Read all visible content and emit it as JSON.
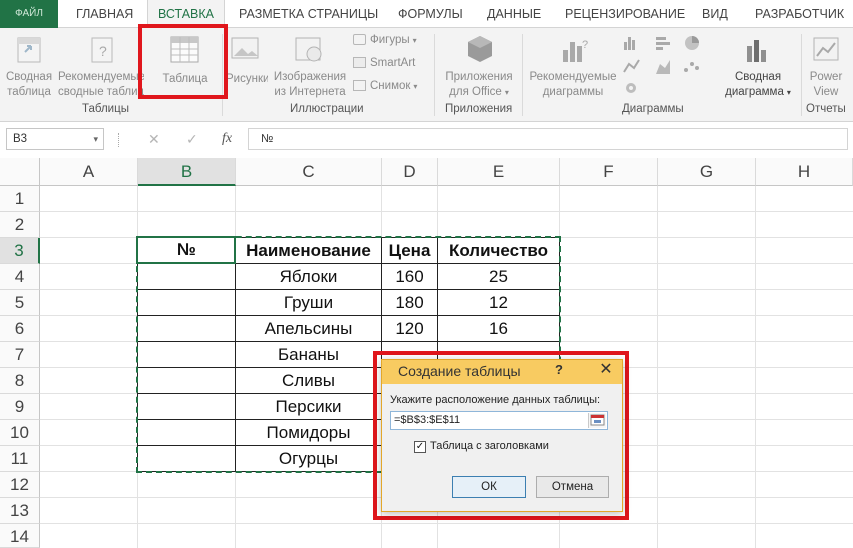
{
  "ribbon": {
    "file_tab": "ФАЙЛ",
    "tabs": [
      "ГЛАВНАЯ",
      "ВСТАВКА",
      "РАЗМЕТКА СТРАНИЦЫ",
      "ФОРМУЛЫ",
      "ДАННЫЕ",
      "РЕЦЕНЗИРОВАНИЕ",
      "ВИД",
      "РАЗРАБОТЧИК"
    ],
    "active_tab": "ВСТАВКА",
    "buttons": {
      "pivot_line1": "Сводная",
      "pivot_line2": "таблица",
      "rec_tables_line1": "Рекомендуемые",
      "rec_tables_line2": "сводные таблицы",
      "table": "Таблица",
      "pictures": "Рисунки",
      "online_line1": "Изображения",
      "online_line2": "из Интернета",
      "shapes": "Фигуры",
      "smartart": "SmartArt",
      "screenshot": "Снимок",
      "apps_line1": "Приложения",
      "apps_line2": "для Office",
      "rec_charts_line1": "Рекомендуемые",
      "rec_charts_line2": "диаграммы",
      "pivot_chart_line1": "Сводная",
      "pivot_chart_line2": "диаграмма",
      "power_line1": "Power",
      "power_line2": "View"
    },
    "groups": {
      "tables": "Таблицы",
      "illustrations": "Иллюстрации",
      "apps": "Приложения",
      "charts": "Диаграммы",
      "reports": "Отчеты"
    }
  },
  "formula_bar": {
    "name_box": "B3",
    "cancel_symbol": "✕",
    "enter_symbol": "✓",
    "fx_label": "fx",
    "content": "№"
  },
  "grid": {
    "columns": [
      "A",
      "B",
      "C",
      "D",
      "E",
      "F",
      "G",
      "H"
    ],
    "selected_column": "B",
    "rows": [
      "1",
      "2",
      "3",
      "4",
      "5",
      "6",
      "7",
      "8",
      "9",
      "10",
      "11",
      "12",
      "13",
      "14"
    ],
    "selected_row": "3"
  },
  "table": {
    "headers": [
      "№",
      "Наименование",
      "Цена",
      "Количество"
    ],
    "rows": [
      {
        "name": "Яблоки",
        "price": "160",
        "qty": "25"
      },
      {
        "name": "Груши",
        "price": "180",
        "qty": "12"
      },
      {
        "name": "Апельсины",
        "price": "120",
        "qty": "16"
      },
      {
        "name": "Бананы",
        "price": "",
        "qty": ""
      },
      {
        "name": "Сливы",
        "price": "",
        "qty": ""
      },
      {
        "name": "Персики",
        "price": "",
        "qty": ""
      },
      {
        "name": "Помидоры",
        "price": "",
        "qty": ""
      },
      {
        "name": "Огурцы",
        "price": "",
        "qty": ""
      }
    ]
  },
  "dialog": {
    "title": "Создание таблицы",
    "help": "?",
    "close": "✕",
    "prompt": "Укажите расположение данных таблицы:",
    "range_value": "=$B$3:$E$11",
    "has_headers_label": "Таблица с заголовками",
    "has_headers_checked": true,
    "ok_label": "ОК",
    "cancel_label": "Отмена"
  },
  "colors": {
    "excel_green": "#217346",
    "highlight_red": "#e0161c",
    "dialog_title": "#f8cb61"
  }
}
